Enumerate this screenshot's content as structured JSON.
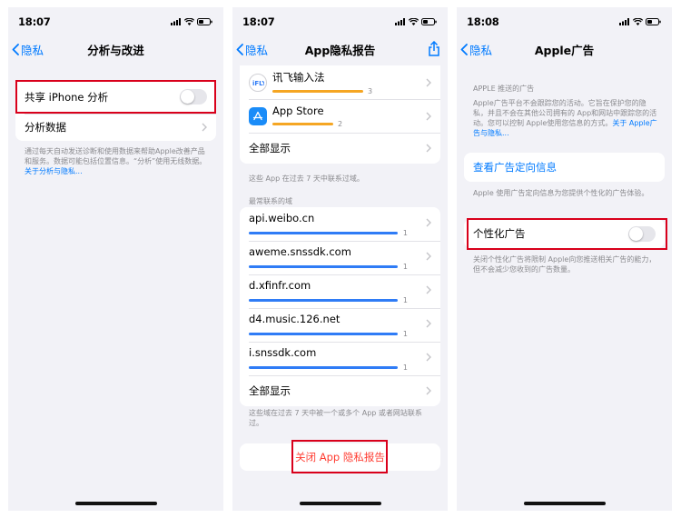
{
  "colors": {
    "accent": "#007aff",
    "destructive": "#ff3b30",
    "highlight": "#d9001b",
    "orange_bar": "#f5a623",
    "blue_bar": "#2f7cf6"
  },
  "screen1": {
    "time": "18:07",
    "back": "隐私",
    "title": "分析与改进",
    "rows": {
      "share_analytics": "共享 iPhone 分析",
      "analytics_data": "分析数据"
    },
    "toggle_on": false,
    "footer_text": "通过每天自动发送诊断和使用数据来帮助Apple改善产品和服务。数据可能包括位置信息。“分析”使用无线数据。",
    "footer_link": "关于分析与隐私..."
  },
  "screen2": {
    "time": "18:07",
    "back": "隐私",
    "title": "App隐私报告",
    "apps": [
      {
        "name": "讯飞输入法",
        "count": "3",
        "fraction": 1.0,
        "icon": "ifly-icon"
      },
      {
        "name": "App Store",
        "count": "2",
        "fraction": 0.67,
        "icon": "app-store-icon"
      }
    ],
    "show_all": "全部显示",
    "apps_footer": "这些 App 在过去 7 天中联系过域。",
    "domains_header": "最常联系的域",
    "domains": [
      {
        "name": "api.weibo.cn",
        "count": "1"
      },
      {
        "name": "aweme.snssdk.com",
        "count": "1"
      },
      {
        "name": "d.xfinfr.com",
        "count": "1"
      },
      {
        "name": "d4.music.126.net",
        "count": "1"
      },
      {
        "name": "i.snssdk.com",
        "count": "1"
      }
    ],
    "show_all_domains": "全部显示",
    "domains_footer": "这些域在过去 7 天中被一个或多个 App 或者网站联系过。",
    "close_report": "关闭 App 隐私报告"
  },
  "screen3": {
    "time": "18:08",
    "back": "隐私",
    "title": "Apple广告",
    "section_header": "APPLE 推送的广告",
    "intro_text": "Apple广告平台不会跟踪您的活动。它旨在保护您的隐私，并且不会在其他公司拥有的 App和网站中跟踪您的活动。您可以控制 Apple使用您信息的方式。",
    "intro_link": "关于 Apple广告与隐私...",
    "view_targeting": "查看广告定向信息",
    "targeting_footer": "Apple 使用广告定向信息为您提供个性化的广告体验。",
    "personalized_ads": "个性化广告",
    "toggle_on": false,
    "personalized_footer": "关闭个性化广告将限制 Apple向您推送相关广告的能力，但不会减少您收到的广告数量。"
  }
}
